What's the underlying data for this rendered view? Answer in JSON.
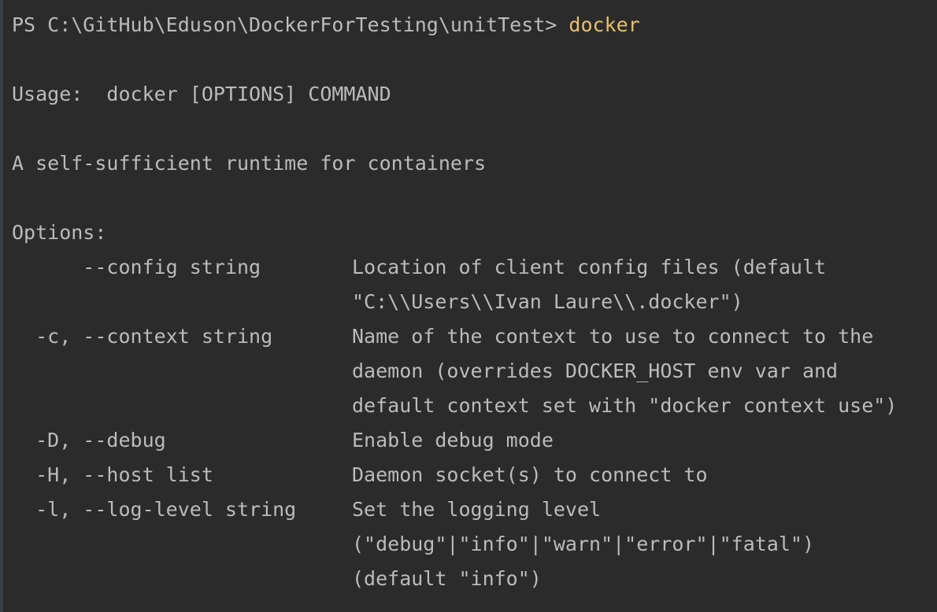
{
  "prompt": {
    "text": "PS C:\\GitHub\\Eduson\\DockerForTesting\\unitTest> ",
    "command": "docker"
  },
  "usage": "Usage:  docker [OPTIONS] COMMAND",
  "description": "A self-sufficient runtime for containers",
  "options_header": "Options:",
  "options": [
    {
      "flag": "      --config string",
      "desc": [
        "Location of client config files (default",
        "\"C:\\\\Users\\\\Ivan Laure\\\\.docker\")"
      ]
    },
    {
      "flag": "  -c, --context string",
      "desc": [
        "Name of the context to use to connect to the",
        "daemon (overrides DOCKER_HOST env var and",
        "default context set with \"docker context use\")"
      ]
    },
    {
      "flag": "  -D, --debug",
      "desc": [
        "Enable debug mode"
      ]
    },
    {
      "flag": "  -H, --host list",
      "desc": [
        "Daemon socket(s) to connect to"
      ]
    },
    {
      "flag": "  -l, --log-level string",
      "desc": [
        "Set the logging level",
        "(\"debug\"|\"info\"|\"warn\"|\"error\"|\"fatal\")",
        "(default \"info\")"
      ]
    }
  ],
  "colors": {
    "background": "#2b2b2b",
    "text": "#bbbbbb",
    "command": "#e8bf6a"
  }
}
